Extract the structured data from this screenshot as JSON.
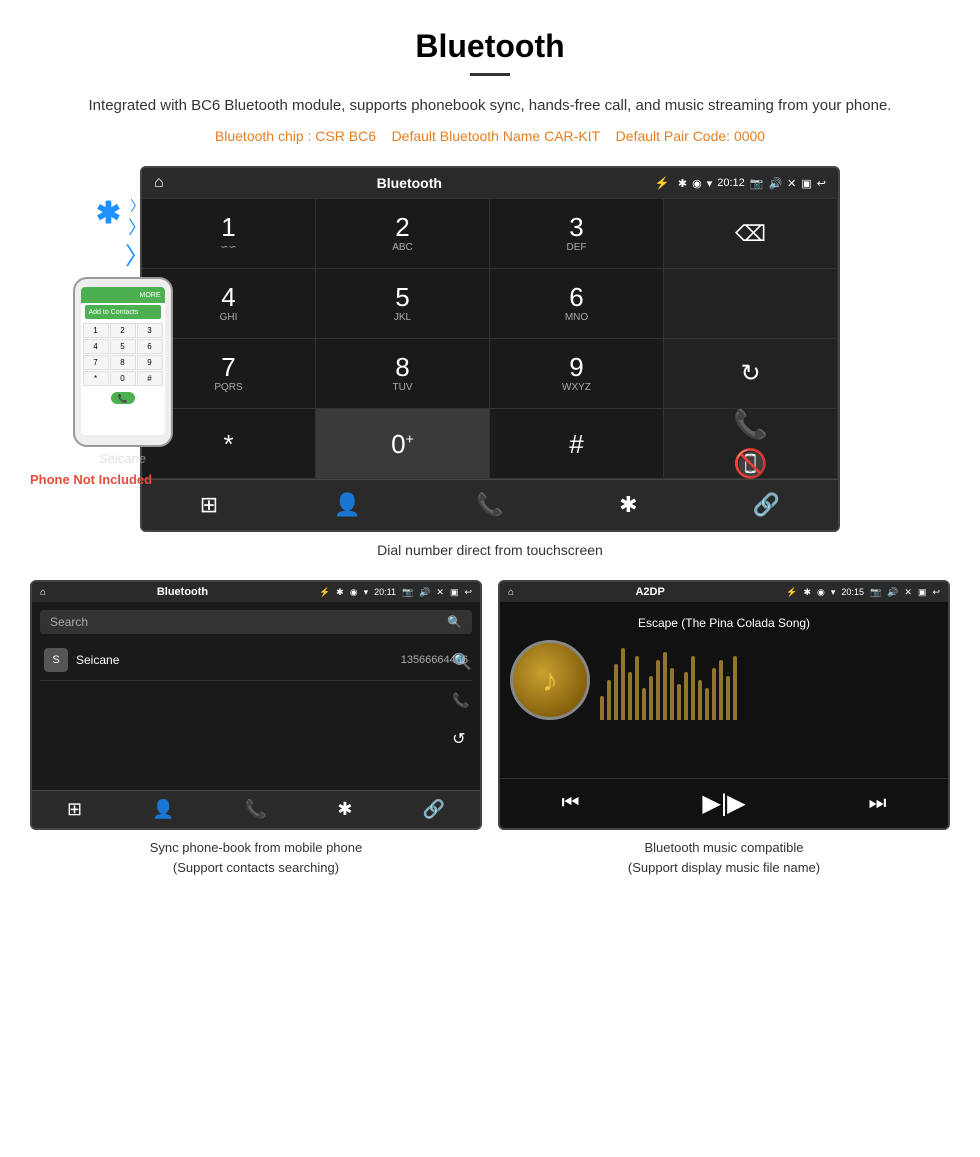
{
  "page": {
    "title": "Bluetooth",
    "description": "Integrated with BC6 Bluetooth module, supports phonebook sync, hands-free call, and music streaming from your phone.",
    "specs": "(Bluetooth chip : CSR BC6     Default Bluetooth Name CAR-KIT     Default Pair Code: 0000)",
    "specs_parts": {
      "chip": "Bluetooth chip : CSR BC6",
      "name": "Default Bluetooth Name CAR-KIT",
      "code": "Default Pair Code: 0000"
    }
  },
  "phone_label": "Phone Not Included",
  "dial_screen": {
    "statusbar": {
      "home_icon": "⌂",
      "title": "Bluetooth",
      "usb_icon": "⚡",
      "bt_icon": "✱",
      "loc_icon": "◉",
      "wifi_icon": "▾",
      "time": "20:12",
      "camera_icon": "📷",
      "vol_icon": "🔊",
      "close_icon": "✕",
      "window_icon": "▣",
      "back_icon": "↩"
    },
    "keys": [
      {
        "main": "1",
        "sub": "∽∽"
      },
      {
        "main": "2",
        "sub": "ABC"
      },
      {
        "main": "3",
        "sub": "DEF"
      },
      {
        "main": "",
        "sub": "",
        "type": "backspace"
      },
      {
        "main": "4",
        "sub": "GHI"
      },
      {
        "main": "5",
        "sub": "JKL"
      },
      {
        "main": "6",
        "sub": "MNO"
      },
      {
        "main": "",
        "sub": "",
        "type": "empty"
      },
      {
        "main": "7",
        "sub": "PQRS"
      },
      {
        "main": "8",
        "sub": "TUV"
      },
      {
        "main": "9",
        "sub": "WXYZ"
      },
      {
        "main": "",
        "sub": "",
        "type": "reload"
      },
      {
        "main": "*",
        "sub": ""
      },
      {
        "main": "0",
        "sub": "+"
      },
      {
        "main": "#",
        "sub": ""
      },
      {
        "main": "",
        "sub": "",
        "type": "call-green"
      },
      {
        "main": "",
        "sub": "",
        "type": "call-red"
      }
    ],
    "bottom_icons": [
      "⊞",
      "👤",
      "📞",
      "✱",
      "🔗"
    ]
  },
  "dial_caption": "Dial number direct from touchscreen",
  "phonebook_screen": {
    "statusbar_title": "Bluetooth",
    "time": "20:11",
    "search_placeholder": "Search",
    "contacts": [
      {
        "letter": "S",
        "name": "Seicane",
        "number": "13566664466"
      }
    ],
    "right_icons": [
      "🔍",
      "📞",
      "↺"
    ],
    "bottom_icons": [
      "⊞",
      "👤",
      "📞",
      "✱",
      "🔗"
    ],
    "active_bottom": 1
  },
  "phonebook_caption": "Sync phone-book from mobile phone\n(Support contacts searching)",
  "music_screen": {
    "statusbar_title": "A2DP",
    "time": "20:15",
    "song_title": "Escape (The Pina Colada Song)",
    "music_icon": "♪",
    "controls": [
      "⏮",
      "⏯",
      "⏭"
    ],
    "eq_bars": [
      30,
      50,
      70,
      90,
      60,
      80,
      40,
      55,
      75,
      85,
      65,
      45,
      60,
      80,
      50,
      40,
      65,
      75,
      55,
      80
    ]
  },
  "music_caption": "Bluetooth music compatible\n(Support display music file name)"
}
